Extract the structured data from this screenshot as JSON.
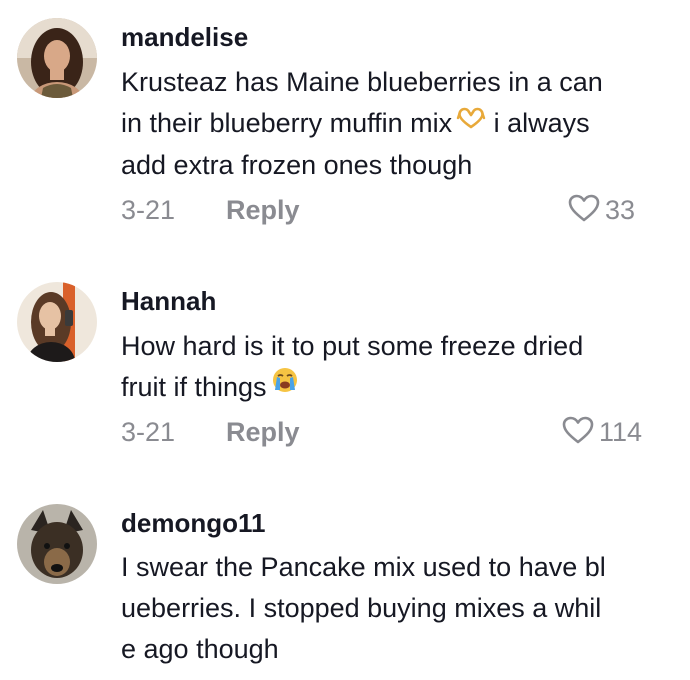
{
  "comments": [
    {
      "username": "mandelise",
      "lines": [
        "Krusteaz has Maine blueberries in a can",
        "in their blueberry muffin mix",
        "add extra frozen ones though"
      ],
      "line2_suffix": "i always",
      "emoji_name": "heart-hands-emoji",
      "date": "3-21",
      "reply_label": "Reply",
      "likes": "33"
    },
    {
      "username": "Hannah",
      "lines": [
        "How hard is it to put some freeze dried",
        "fruit if things"
      ],
      "emoji_name": "loudly-crying-face-emoji",
      "date": "3-21",
      "reply_label": "Reply",
      "likes": "114"
    },
    {
      "username": "demongo11",
      "lines": [
        "I swear the Pancake mix used to have bl",
        "ueberries. I stopped buying mixes a whil",
        "e ago though"
      ]
    }
  ],
  "colors": {
    "text": "#161823",
    "muted": "#8a8b91",
    "background": "#ffffff"
  }
}
